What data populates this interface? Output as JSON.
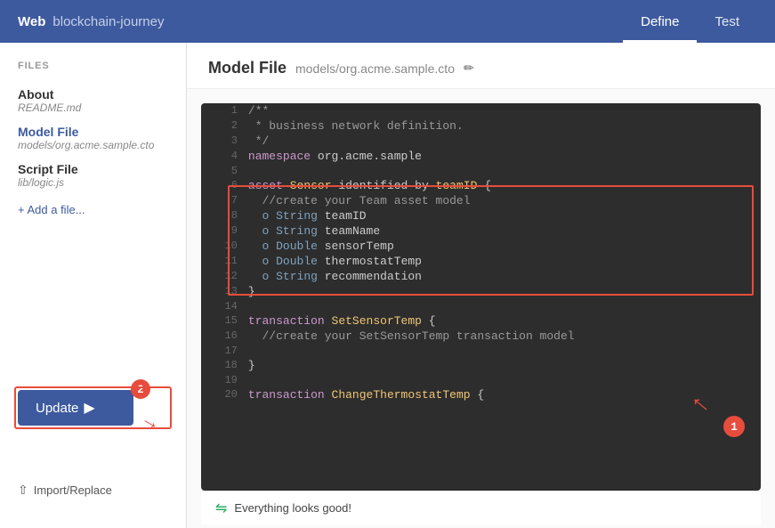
{
  "header": {
    "logo": "Web",
    "title": "blockchain-journey",
    "tabs": [
      {
        "label": "Define",
        "active": true
      },
      {
        "label": "Test",
        "active": false
      }
    ]
  },
  "sidebar": {
    "section_label": "FILES",
    "items": [
      {
        "title": "About",
        "subtitle": "README.md",
        "active": false
      },
      {
        "title": "Model File",
        "subtitle": "models/org.acme.sample.cto",
        "active": true
      },
      {
        "title": "Script File",
        "subtitle": "lib/logic.js",
        "active": false
      }
    ],
    "add_file_label": "+ Add a file...",
    "update_button": "Update",
    "import_replace": "Import/Replace"
  },
  "content": {
    "title": "Model File",
    "path": "models/org.acme.sample.cto",
    "code_lines": [
      {
        "num": 1,
        "code": "/**"
      },
      {
        "num": 2,
        "code": " * business network definition."
      },
      {
        "num": 3,
        "code": " */"
      },
      {
        "num": 4,
        "code": "namespace org.acme.sample"
      },
      {
        "num": 5,
        "code": ""
      },
      {
        "num": 6,
        "code": "asset Sensor identified by teamID {"
      },
      {
        "num": 7,
        "code": "  //create your Team asset model"
      },
      {
        "num": 8,
        "code": "  o String teamID"
      },
      {
        "num": 9,
        "code": "  o String teamName"
      },
      {
        "num": 10,
        "code": "  o Double sensorTemp"
      },
      {
        "num": 11,
        "code": "  o Double thermostatTemp"
      },
      {
        "num": 12,
        "code": "  o String recommendation"
      },
      {
        "num": 13,
        "code": "}"
      },
      {
        "num": 14,
        "code": ""
      },
      {
        "num": 15,
        "code": "transaction SetSensorTemp {"
      },
      {
        "num": 16,
        "code": "  //create your SetSensorTemp transaction model"
      },
      {
        "num": 17,
        "code": ""
      },
      {
        "num": 18,
        "code": "}"
      },
      {
        "num": 19,
        "code": ""
      },
      {
        "num": 20,
        "code": "transaction ChangeThermostatTemp {"
      }
    ],
    "status_message": "Everything looks good!"
  }
}
